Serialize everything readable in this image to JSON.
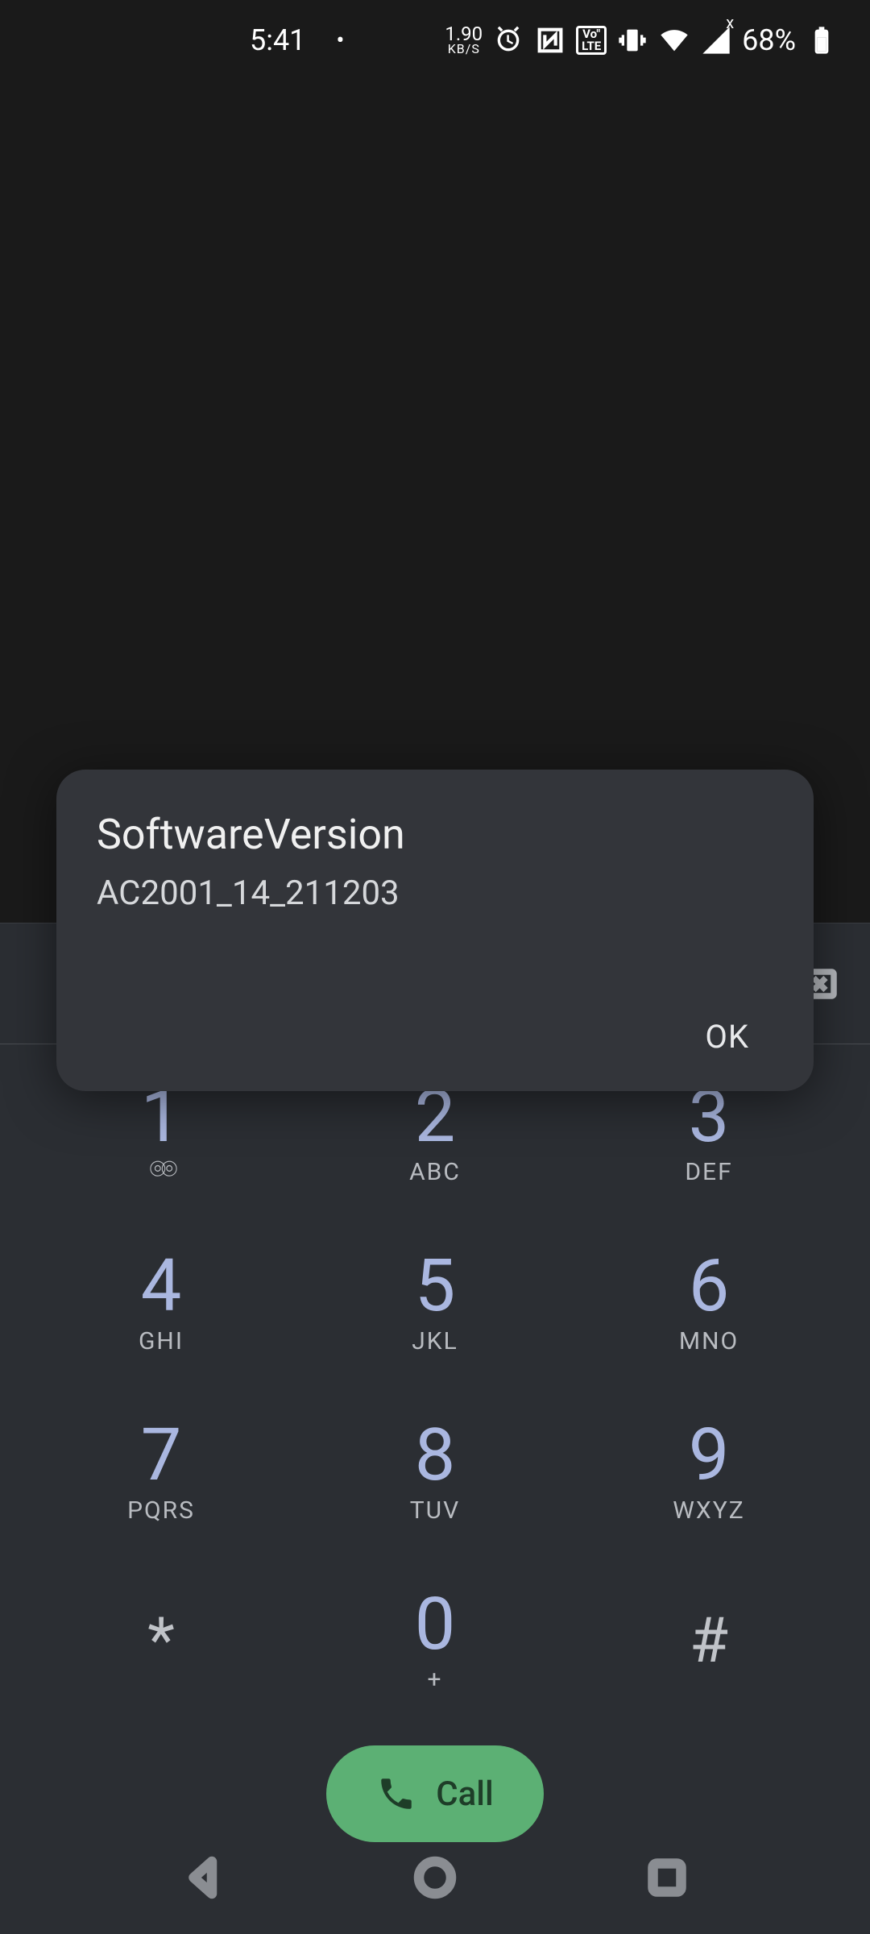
{
  "status": {
    "time": "5:41",
    "net_speed_value": "1.90",
    "net_speed_unit": "KB/S",
    "volte_top": "Vo\"",
    "volte_bot": "LTE",
    "signal_x": "x",
    "battery_pct": "68%"
  },
  "dialog": {
    "title": "SoftwareVersion",
    "body": "AC2001_14_211203",
    "ok": "OK"
  },
  "keypad": {
    "k1": {
      "digit": "1",
      "sub": ""
    },
    "k2": {
      "digit": "2",
      "sub": "ABC"
    },
    "k3": {
      "digit": "3",
      "sub": "DEF"
    },
    "k4": {
      "digit": "4",
      "sub": "GHI"
    },
    "k5": {
      "digit": "5",
      "sub": "JKL"
    },
    "k6": {
      "digit": "6",
      "sub": "MNO"
    },
    "k7": {
      "digit": "7",
      "sub": "PQRS"
    },
    "k8": {
      "digit": "8",
      "sub": "TUV"
    },
    "k9": {
      "digit": "9",
      "sub": "WXYZ"
    },
    "kstar": {
      "digit": "*"
    },
    "k0": {
      "digit": "0",
      "sub": "+"
    },
    "khash": {
      "digit": "#"
    }
  },
  "call": {
    "label": "Call"
  }
}
